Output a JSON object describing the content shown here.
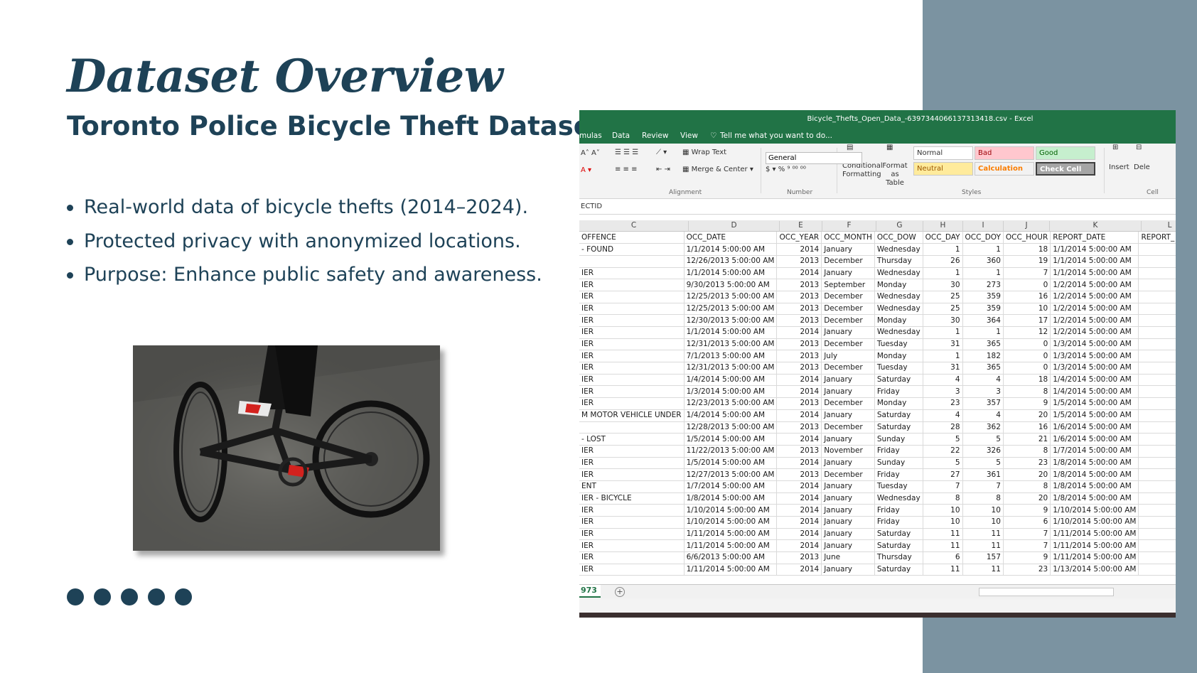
{
  "slide": {
    "title": "Dataset Overview",
    "subtitle": "Toronto Police Bicycle Theft Dataset",
    "bullets": [
      "Real-world data of bicycle thefts (2014–2024).",
      "Protected privacy with anonymized locations.",
      "Purpose: Enhance public safety and awareness."
    ],
    "colors": {
      "accent": "#1e4257",
      "side_panel": "#7b93a1",
      "excel_green": "#217346"
    }
  },
  "excel": {
    "window_title": "Bicycle_Thefts_Open_Data_-6397344066137313418.csv - Excel",
    "menu": [
      "mulas",
      "Data",
      "Review",
      "View",
      "Tell me what you want to do..."
    ],
    "ribbon": {
      "wrap_text": "Wrap Text",
      "merge_center": "Merge & Center",
      "number_format": "General",
      "conditional_formatting": "Conditional Formatting",
      "format_as_table": "Format as Table",
      "insert": "Insert",
      "delete": "Dele",
      "groups": {
        "alignment": "Alignment",
        "number": "Number",
        "styles": "Styles",
        "cells": "Cell"
      },
      "styles": {
        "normal": "Normal",
        "bad": "Bad",
        "good": "Good",
        "neutral": "Neutral",
        "calculation": "Calculation",
        "check_cell": "Check Cell"
      }
    },
    "name_box": "ECTID",
    "column_letters": [
      "C",
      "D",
      "E",
      "F",
      "G",
      "H",
      "I",
      "J",
      "K",
      "L"
    ],
    "headers": [
      "OFFENCE",
      "OCC_DATE",
      "OCC_YEAR",
      "OCC_MONTH",
      "OCC_DOW",
      "OCC_DAY",
      "OCC_DOY",
      "OCC_HOUR",
      "REPORT_DATE",
      "REPORT_"
    ],
    "rows": [
      [
        "- FOUND",
        "1/1/2014 5:00:00 AM",
        "2014",
        "January",
        "Wednesday",
        "1",
        "1",
        "18",
        "1/1/2014 5:00:00 AM",
        ""
      ],
      [
        "",
        "12/26/2013 5:00:00 AM",
        "2013",
        "December",
        "Thursday",
        "26",
        "360",
        "19",
        "1/1/2014 5:00:00 AM",
        ""
      ],
      [
        "IER",
        "1/1/2014 5:00:00 AM",
        "2014",
        "January",
        "Wednesday",
        "1",
        "1",
        "7",
        "1/1/2014 5:00:00 AM",
        ""
      ],
      [
        "IER",
        "9/30/2013 5:00:00 AM",
        "2013",
        "September",
        "Monday",
        "30",
        "273",
        "0",
        "1/2/2014 5:00:00 AM",
        ""
      ],
      [
        "IER",
        "12/25/2013 5:00:00 AM",
        "2013",
        "December",
        "Wednesday",
        "25",
        "359",
        "16",
        "1/2/2014 5:00:00 AM",
        ""
      ],
      [
        "IER",
        "12/25/2013 5:00:00 AM",
        "2013",
        "December",
        "Wednesday",
        "25",
        "359",
        "10",
        "1/2/2014 5:00:00 AM",
        ""
      ],
      [
        "IER",
        "12/30/2013 5:00:00 AM",
        "2013",
        "December",
        "Monday",
        "30",
        "364",
        "17",
        "1/2/2014 5:00:00 AM",
        ""
      ],
      [
        "IER",
        "1/1/2014 5:00:00 AM",
        "2014",
        "January",
        "Wednesday",
        "1",
        "1",
        "12",
        "1/2/2014 5:00:00 AM",
        ""
      ],
      [
        "IER",
        "12/31/2013 5:00:00 AM",
        "2013",
        "December",
        "Tuesday",
        "31",
        "365",
        "0",
        "1/3/2014 5:00:00 AM",
        ""
      ],
      [
        "IER",
        "7/1/2013 5:00:00 AM",
        "2013",
        "July",
        "Monday",
        "1",
        "182",
        "0",
        "1/3/2014 5:00:00 AM",
        ""
      ],
      [
        "IER",
        "12/31/2013 5:00:00 AM",
        "2013",
        "December",
        "Tuesday",
        "31",
        "365",
        "0",
        "1/3/2014 5:00:00 AM",
        ""
      ],
      [
        "IER",
        "1/4/2014 5:00:00 AM",
        "2014",
        "January",
        "Saturday",
        "4",
        "4",
        "18",
        "1/4/2014 5:00:00 AM",
        ""
      ],
      [
        "IER",
        "1/3/2014 5:00:00 AM",
        "2014",
        "January",
        "Friday",
        "3",
        "3",
        "8",
        "1/4/2014 5:00:00 AM",
        ""
      ],
      [
        "IER",
        "12/23/2013 5:00:00 AM",
        "2013",
        "December",
        "Monday",
        "23",
        "357",
        "9",
        "1/5/2014 5:00:00 AM",
        ""
      ],
      [
        "M MOTOR VEHICLE UNDER",
        "1/4/2014 5:00:00 AM",
        "2014",
        "January",
        "Saturday",
        "4",
        "4",
        "20",
        "1/5/2014 5:00:00 AM",
        ""
      ],
      [
        "",
        "12/28/2013 5:00:00 AM",
        "2013",
        "December",
        "Saturday",
        "28",
        "362",
        "16",
        "1/6/2014 5:00:00 AM",
        ""
      ],
      [
        "- LOST",
        "1/5/2014 5:00:00 AM",
        "2014",
        "January",
        "Sunday",
        "5",
        "5",
        "21",
        "1/6/2014 5:00:00 AM",
        ""
      ],
      [
        "IER",
        "11/22/2013 5:00:00 AM",
        "2013",
        "November",
        "Friday",
        "22",
        "326",
        "8",
        "1/7/2014 5:00:00 AM",
        ""
      ],
      [
        "IER",
        "1/5/2014 5:00:00 AM",
        "2014",
        "January",
        "Sunday",
        "5",
        "5",
        "23",
        "1/8/2014 5:00:00 AM",
        ""
      ],
      [
        "IER",
        "12/27/2013 5:00:00 AM",
        "2013",
        "December",
        "Friday",
        "27",
        "361",
        "20",
        "1/8/2014 5:00:00 AM",
        ""
      ],
      [
        "ENT",
        "1/7/2014 5:00:00 AM",
        "2014",
        "January",
        "Tuesday",
        "7",
        "7",
        "8",
        "1/8/2014 5:00:00 AM",
        ""
      ],
      [
        "IER - BICYCLE",
        "1/8/2014 5:00:00 AM",
        "2014",
        "January",
        "Wednesday",
        "8",
        "8",
        "20",
        "1/8/2014 5:00:00 AM",
        ""
      ],
      [
        "IER",
        "1/10/2014 5:00:00 AM",
        "2014",
        "January",
        "Friday",
        "10",
        "10",
        "9",
        "1/10/2014 5:00:00 AM",
        ""
      ],
      [
        "IER",
        "1/10/2014 5:00:00 AM",
        "2014",
        "January",
        "Friday",
        "10",
        "10",
        "6",
        "1/10/2014 5:00:00 AM",
        ""
      ],
      [
        "IER",
        "1/11/2014 5:00:00 AM",
        "2014",
        "January",
        "Saturday",
        "11",
        "11",
        "7",
        "1/11/2014 5:00:00 AM",
        ""
      ],
      [
        "IER",
        "1/11/2014 5:00:00 AM",
        "2014",
        "January",
        "Saturday",
        "11",
        "11",
        "7",
        "1/11/2014 5:00:00 AM",
        ""
      ],
      [
        "IER",
        "6/6/2013 5:00:00 AM",
        "2013",
        "June",
        "Thursday",
        "6",
        "157",
        "9",
        "1/11/2014 5:00:00 AM",
        ""
      ],
      [
        "IER",
        "1/11/2014 5:00:00 AM",
        "2014",
        "January",
        "Saturday",
        "11",
        "11",
        "23",
        "1/13/2014 5:00:00 AM",
        ""
      ]
    ],
    "sheet_tab": "973"
  }
}
